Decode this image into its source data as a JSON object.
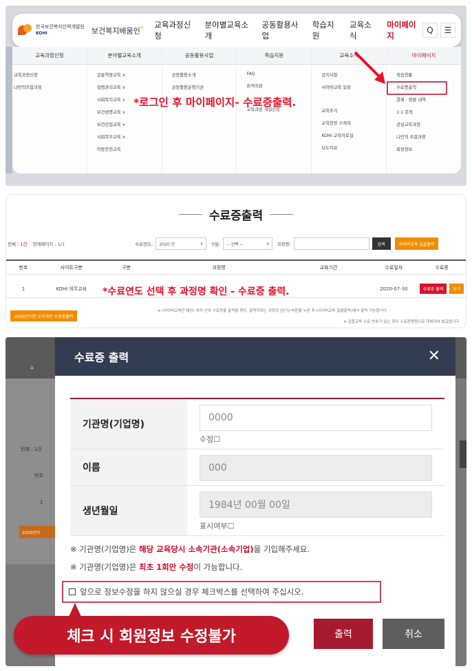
{
  "panel1": {
    "logo_org": "한국보건복지인력개발원",
    "logo_en": "KOHI",
    "site_name": "보건복지배움인",
    "menu": [
      "교육과정신청",
      "분야별교육소개",
      "공동활용사업",
      "학습지원",
      "교육소식",
      "마이페이지"
    ],
    "search_icon": "Q",
    "menu_icon": "☰",
    "mega_columns": [
      {
        "head": "교육과정신청",
        "items": [
          "교육과정신청",
          "나만의조합과정"
        ]
      },
      {
        "head": "분야별교육소개",
        "items": [
          "공통역량교육 ∨",
          "질병관리교육 ∨",
          "사회복지교육 ∨",
          "보건생명교육 ∨",
          "보건산업교육 ∨",
          "사회복무교육 ∨",
          "아동안전교육"
        ]
      },
      {
        "head": "공동활용사업",
        "items": [
          "공동활용소개",
          "공동활용운영기관"
        ]
      },
      {
        "head": "학습지원",
        "items": [
          "FAQ",
          "원격지원",
          "",
          "교육과정 개설신청"
        ]
      },
      {
        "head": "교육소식",
        "items": [
          "공지사항",
          "사이버교육 일정",
          "",
          "교육후기",
          "교육현장 스케치",
          "KOHI 교육자료실",
          "보도자료"
        ]
      },
      {
        "head": "마이페이지",
        "items": [
          "학습현황",
          "수료증출력",
          "결제 · 환불 내역",
          "1:1 문의",
          "관심교육과정",
          "나만의 조합과정",
          "회원정보"
        ]
      }
    ],
    "overlay_note": "*로그인 후 마이페이지- 수료증출력."
  },
  "panel2": {
    "title": "수료증출력",
    "count_prefix": "전체 : ",
    "count_value": "1건",
    "page_info": "현재페이지 : 1/1",
    "year_label": "수료연도:",
    "year_value": "2020 년",
    "type_label": "구분:",
    "type_value": "-- 선택 --",
    "course_label": "과정명:",
    "search_btn": "검색",
    "cyber_btn": "사이버교육 일괄출력",
    "headers": [
      "번호",
      "사이트구분",
      "구분",
      "과정명",
      "교육기간",
      "수료일자",
      "수료증"
    ],
    "row": {
      "no": "1",
      "site": "KOHI 의무교육",
      "date": "2020-07-30",
      "print": "수료증 출력",
      "close": "닫기"
    },
    "overlay_note": "*수료연도 선택 후 과정명 확인 - 수료증 출력.",
    "note_bar": "2020년이전 오프라인 수료증출력",
    "note1": "※ (사이버교육만 해당) 여러 건의 수료증을 출력할 경우, 출력하려는 과정의 [닫기] 버튼을 누른 후 (사이버교육 일괄출력)에서 출력 가능합니다.",
    "note2": "※ 집합교육 수료 번호가 없는 경우 수료증명원으로 대체하여 발급됩니다."
  },
  "panel3": {
    "bg_count": "전체 : 1건",
    "bg_no": "번호",
    "bg_one": "1",
    "bg_orange": "2020년이",
    "bg_home": "⌂",
    "modal_title": "수료증 출력",
    "close_icon": "✕",
    "fields": [
      {
        "label": "기관명(기업명)",
        "value": "0000",
        "sub": "수정☐"
      },
      {
        "label": "이름",
        "value": "000",
        "sub": ""
      },
      {
        "label": "생년월일",
        "value": "1984년 00월 00일",
        "sub": "표시여부☐"
      }
    ],
    "note1_pre": "※ 기관명(기업명)은 ",
    "note1_bold": "해당 교육당시 소속기관(소속기업)",
    "note1_post": "을 기입해주세요.",
    "note2_pre": "※ 기관명(기업명)은 ",
    "note2_bold": "최초 1회만 수정",
    "note2_post": "이 가능합니다.",
    "agree_text": "앞으로 정보수정을 하지 않으실 경우 체크박스를 선택하여 주십시오.",
    "callout": "체크 시 회원정보 수정불가",
    "print_btn": "출력",
    "cancel_btn": "취소"
  }
}
